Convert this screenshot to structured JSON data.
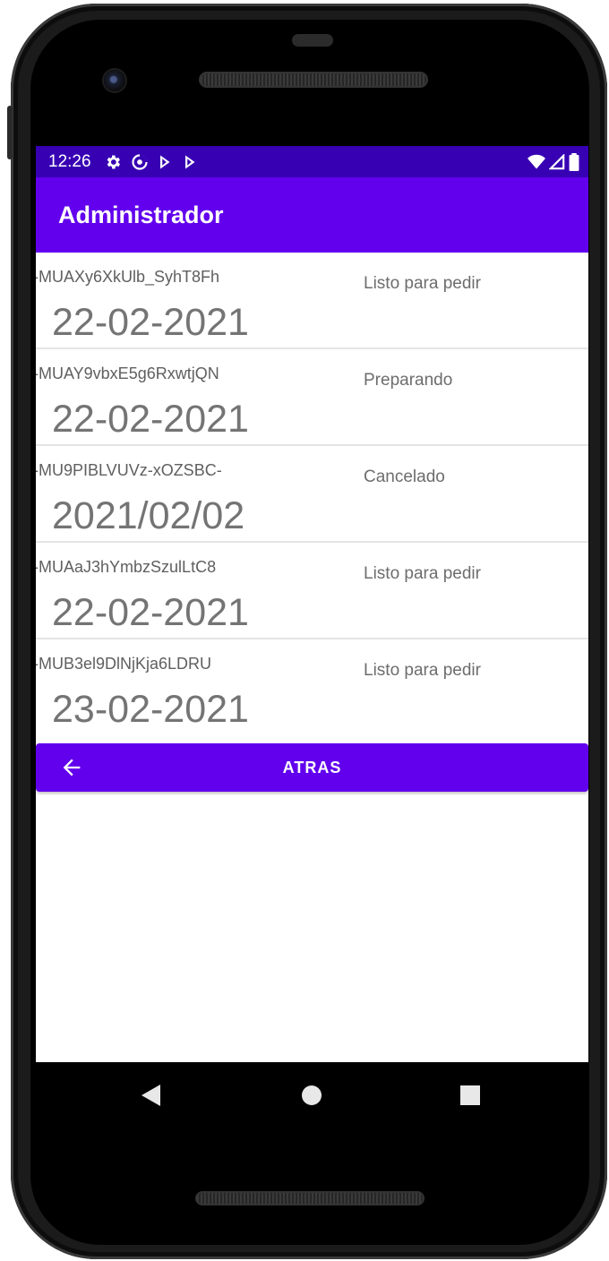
{
  "status_bar": {
    "time": "12:26",
    "icons_left": [
      "settings-icon",
      "sync-icon",
      "play-store-icon",
      "play-store-icon"
    ],
    "icons_right": [
      "wifi-icon",
      "signal-icon",
      "battery-icon"
    ]
  },
  "app_bar": {
    "title": "Administrador"
  },
  "orders": [
    {
      "id": "-MUAXy6XkUlb_SyhT8Fh",
      "status": "Listo para pedir",
      "date": "22-02-2021"
    },
    {
      "id": "-MUAY9vbxE5g6RxwtjQN",
      "status": "Preparando",
      "date": "22-02-2021"
    },
    {
      "id": "-MU9PIBLVUVz-xOZSBC-",
      "status": "Cancelado",
      "date": "2021/02/02"
    },
    {
      "id": "-MUAaJ3hYmbzSzulLtC8",
      "status": "Listo para pedir",
      "date": "22-02-2021"
    },
    {
      "id": "-MUB3el9DlNjKja6LDRU",
      "status": "Listo para pedir",
      "date": "23-02-2021"
    }
  ],
  "back_button": {
    "label": "ATRAS",
    "icon": "arrow-left-icon"
  },
  "nav_bar": {
    "buttons": [
      "back-triangle-icon",
      "home-circle-icon",
      "recents-square-icon"
    ]
  },
  "colors": {
    "primary": "#6200ee",
    "primary_dark": "#3700b3",
    "text_secondary": "#6d6d6d"
  }
}
